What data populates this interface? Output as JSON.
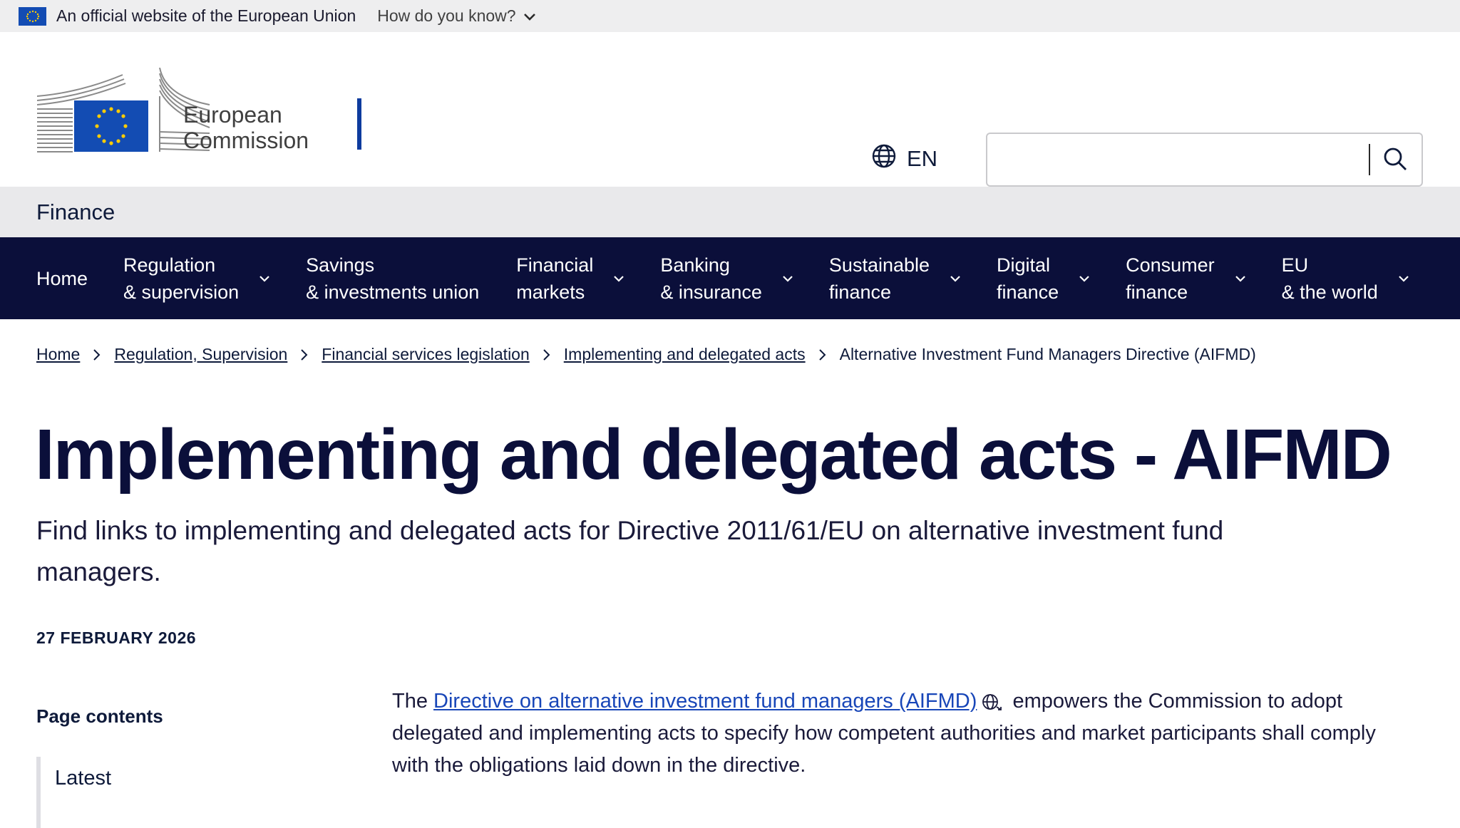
{
  "eu_banner": {
    "official_text": "An official website of the European Union",
    "how_know": "How do you know?"
  },
  "header": {
    "logo_line1": "European",
    "logo_line2": "Commission",
    "language": "EN",
    "search_placeholder": ""
  },
  "site_name": "Finance",
  "nav": [
    {
      "label": "Home",
      "has_dropdown": false
    },
    {
      "label": "Regulation\n& supervision",
      "has_dropdown": true
    },
    {
      "label": "Savings\n& investments union",
      "has_dropdown": false
    },
    {
      "label": "Financial\nmarkets",
      "has_dropdown": true
    },
    {
      "label": "Banking\n& insurance",
      "has_dropdown": true
    },
    {
      "label": "Sustainable\nfinance",
      "has_dropdown": true
    },
    {
      "label": "Digital\nfinance",
      "has_dropdown": true
    },
    {
      "label": "Consumer\nfinance",
      "has_dropdown": true
    },
    {
      "label": "EU\n& the world",
      "has_dropdown": true
    }
  ],
  "breadcrumb": [
    "Home",
    "Regulation, Supervision",
    "Financial services legislation",
    "Implementing and delegated acts",
    "Alternative Investment Fund Managers Directive (AIFMD)"
  ],
  "page": {
    "title": "Implementing and delegated acts - AIFMD",
    "subtitle": "Find links to implementing and delegated acts for Directive 2011/61/EU on alternative investment fund managers.",
    "date": "27 FEBRUARY 2026",
    "toc_heading": "Page contents",
    "toc_items": [
      "Latest"
    ],
    "body_prefix": "The ",
    "body_link": "Directive on alternative investment fund managers (AIFMD)",
    "body_suffix": " empowers the Commission to adopt delegated and implementing acts to specify how competent authorities and market participants shall comply with the obligations laid down in the directive."
  },
  "colors": {
    "nav_bg": "#0b0f3a",
    "link": "#1846b8",
    "eu_blue": "#134cb3",
    "eu_yellow": "#ffcc00"
  }
}
